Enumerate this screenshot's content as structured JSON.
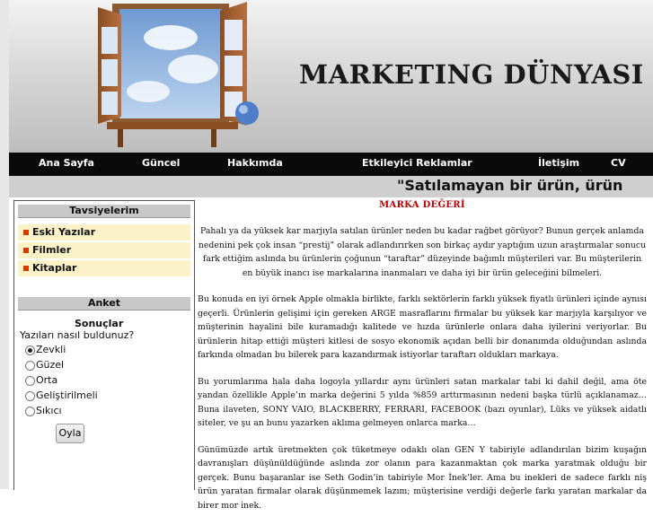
{
  "header": {
    "site_title": "MARKETING DÜNYASI"
  },
  "nav": {
    "items": [
      "Ana Sayfa",
      "Güncel",
      "Hakkımda",
      "Etkileyici Reklamlar",
      "İletişim",
      "CV"
    ]
  },
  "marquee": {
    "text": "\"Satılamayan bir ürün, ürün"
  },
  "sidebar": {
    "recommendations": {
      "title": "Tavsiyelerim",
      "items": [
        "Eski Yazılar",
        "Filmler",
        "Kitaplar"
      ]
    },
    "poll": {
      "title": "Anket",
      "results_label": "Sonuçlar",
      "question": "Yazıları nasıl buldunuz?",
      "options": [
        "Zevkli",
        "Güzel",
        "Orta",
        "Geliştirilmeli",
        "Sıkıcı"
      ],
      "selected": "Zevkli",
      "vote_label": "Oyla"
    }
  },
  "article": {
    "title": "MARKA DEĞERİ",
    "p1": "Pahalı ya da yüksek kar marjıyla satılan ürünler neden bu kadar rağbet görüyor? Bunun gerçek anlamda nedenini pek çok insan “prestij” olarak adlandırırken son birkaç aydır yaptığım uzun araştırmalar sonucu fark ettiğim aslında bu ürünlerin çoğunun “taraftar” düzeyinde bağımlı müşterileri var. Bu müşterilerin en büyük inancı ise markalarına inanmaları ve daha iyi bir ürün geleceğini bilmeleri.",
    "p2": "Bu konuda en iyi örnek Apple olmakla birlikte, farklı sektörlerin farklı yüksek fiyatlı ürünleri içinde aynısı geçerli. Ürünlerin gelişimi için gereken ARGE masraflarını firmalar bu yüksek kar marjıyla karşılıyor ve müşterinin hayalini bile kuramadığı kalitede ve hızda ürünlerle onlara daha iyilerini veriyorlar. Bu ürünlerin hitap ettiği müşteri kitlesi de sosyo ekonomik açıdan belli bir donanımda olduğundan aslında farkında olmadan bu bilerek para kazandırmak istiyorlar taraftarı oldukları markaya.",
    "p3": "Bu yorumlarıma hala daha logoyla yıllardır aynı ürünleri satan markalar tabi ki dahil değil, ama öte yandan özellikle Apple’ın marka değerini 5 yılda %859 arttırmasının nedeni başka türlü açıklanamaz… Buna ilaveten, SONY VAIO, BLACKBERRY, FERRARI, FACEBOOK (bazı oyunlar), Lüks ve yüksek aidatlı siteler, ve şu an bunu yazarken aklıma gelmeyen onlarca marka…",
    "p4": "Günümüzde artık üretmekten çok tüketmeye odaklı olan GEN Y tabiriyle adlandırılan bizim kuşağın davranışları düşünüldüğünde aslında zor olanın para kazanmaktan çok marka yaratmak olduğu bir gerçek. Bunu başaranlar ise Seth Godin’in tabiriyle Mor İnek’ler. Ama bu inekleri de sadece farklı niş ürün yaratan firmalar olarak düşünmemek lazım; müşterisine verdiği değerle farkı yaratan markalar da birer mor inek."
  },
  "colors": {
    "nav_bg": "#0a0a0a",
    "title_red": "#c00000",
    "bullet": "#d63a00",
    "rec_bg": "#fbf2c8"
  }
}
